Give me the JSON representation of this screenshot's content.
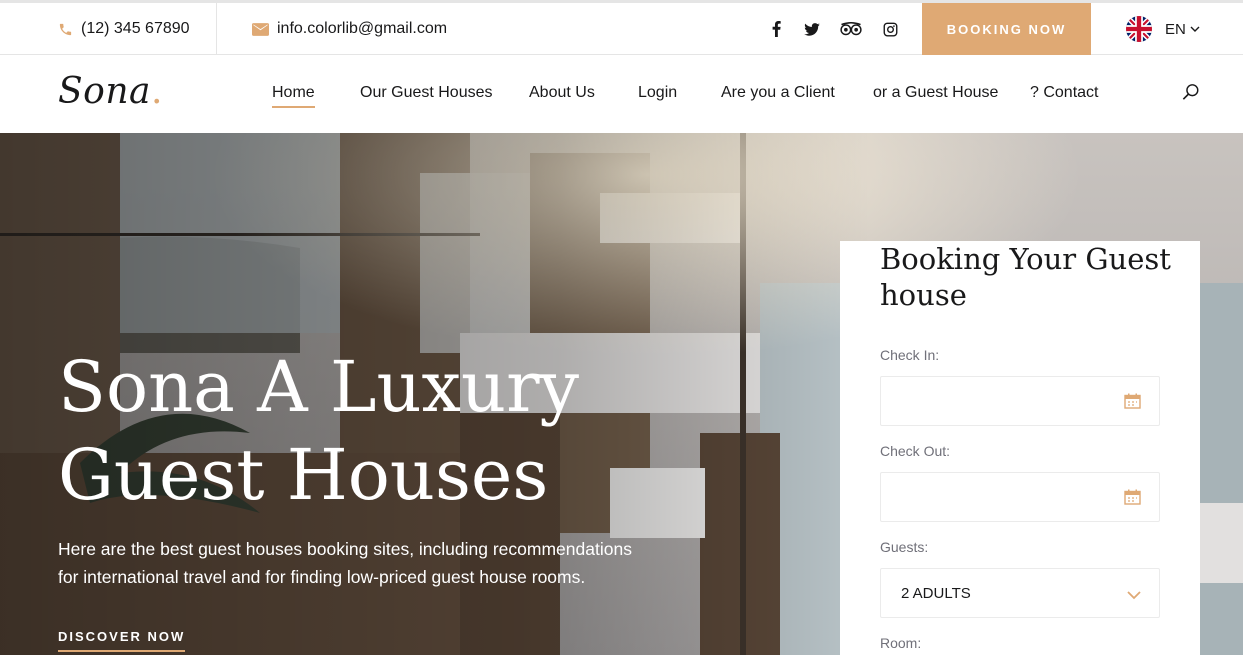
{
  "topbar": {
    "phone": "(12) 345 67890",
    "email": "info.colorlib@gmail.com",
    "social": [
      "facebook-icon",
      "twitter-icon",
      "tripadvisor-icon",
      "instagram-icon"
    ],
    "booking_label": "BOOKING NOW",
    "language": "EN"
  },
  "nav": {
    "logo": "Sona",
    "logo_dot": ".",
    "items": [
      {
        "label": "Home",
        "active": true
      },
      {
        "label": "Our Guest Houses"
      },
      {
        "label": "About Us"
      },
      {
        "label": "Login"
      },
      {
        "label": "Are you a Client"
      },
      {
        "label": "or a Guest House"
      },
      {
        "label": "? Contact"
      }
    ]
  },
  "hero": {
    "title_line1": "Sona A Luxury",
    "title_line2": "Guest Houses",
    "text": "Here are the best guest houses booking sites, including recommendations for international travel and for finding low-priced guest house rooms.",
    "cta": "DISCOVER NOW"
  },
  "booking": {
    "title": "Booking Your Guest house",
    "check_in_label": "Check In:",
    "check_out_label": "Check Out:",
    "guests_label": "Guests:",
    "guests_value": "2 ADULTS",
    "room_label": "Room:"
  },
  "colors": {
    "accent": "#dfa974",
    "text": "#19191a"
  }
}
